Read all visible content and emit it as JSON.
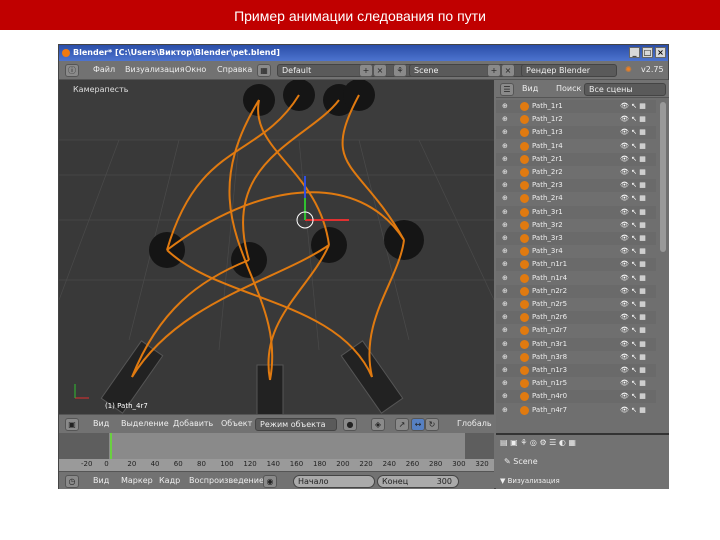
{
  "slide_title": "Пример анимации следования по пути",
  "window": {
    "title": "Blender* [C:\\Users\\Виктор\\Blender\\pet.blend]"
  },
  "main_header": {
    "menu": [
      "Файл",
      "Визуализация",
      "Окно",
      "Справка"
    ],
    "layout": "Default",
    "scene": "Scene",
    "engine": "Рендер Blender",
    "version": "v2.75"
  },
  "viewport": {
    "view_label": "Камерапесть",
    "object_label": "(1) Path_4r7"
  },
  "viewport_header": {
    "menu": [
      "Вид",
      "Выделение",
      "Добавить",
      "Объект"
    ],
    "mode": "Режим объекта",
    "orientation": "Глобаль"
  },
  "outliner": {
    "menu": [
      "Вид",
      "Поиск"
    ],
    "filter": "Все сцены",
    "items": [
      "Path_1r1",
      "Path_1r2",
      "Path_1r3",
      "Path_1r4",
      "Path_2r1",
      "Path_2r2",
      "Path_2r3",
      "Path_2r4",
      "Path_3r1",
      "Path_3r2",
      "Path_3r3",
      "Path_3r4",
      "Path_n1r1",
      "Path_n1r4",
      "Path_n2r2",
      "Path_n2r5",
      "Path_n2r6",
      "Path_n2r7",
      "Path_n3r1",
      "Path_n3r8",
      "Path_n1r3",
      "Path_n1r5",
      "Path_n4r0",
      "Path_n4r7"
    ]
  },
  "properties": {
    "item": "Scene",
    "panel": "Визуализация"
  },
  "timeline": {
    "ticks": [
      "-20",
      "0",
      "20",
      "40",
      "60",
      "80",
      "100",
      "120",
      "140",
      "160",
      "180",
      "200",
      "220",
      "240",
      "260",
      "280",
      "300",
      "320"
    ],
    "menu": [
      "Вид",
      "Маркер",
      "Кадр",
      "Воспроизведение"
    ],
    "start": "Начало",
    "end": "Конец",
    "end_value": "300",
    "current_frame": 0
  },
  "colors": {
    "accent": "#c00000",
    "path": "#e07a10"
  }
}
